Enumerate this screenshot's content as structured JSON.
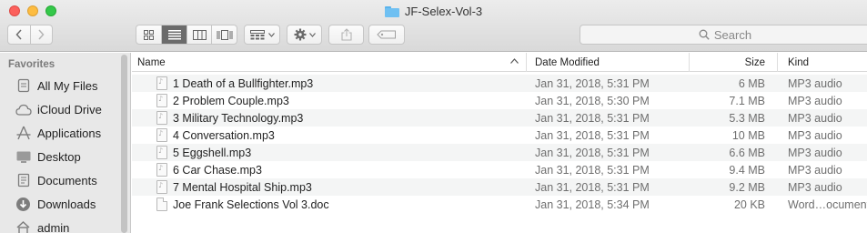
{
  "window": {
    "title": "JF-Selex-Vol-3"
  },
  "toolbar": {
    "back_icon": "chevron-left-icon",
    "forward_icon": "chevron-right-icon",
    "view_modes": [
      "icon",
      "list",
      "column",
      "cover-flow"
    ],
    "active_view": "list",
    "search_placeholder": "Search"
  },
  "sidebar": {
    "heading": "Favorites",
    "items": [
      {
        "label": "All My Files",
        "icon": "all-files-icon"
      },
      {
        "label": "iCloud Drive",
        "icon": "cloud-icon"
      },
      {
        "label": "Applications",
        "icon": "applications-icon"
      },
      {
        "label": "Desktop",
        "icon": "desktop-icon"
      },
      {
        "label": "Documents",
        "icon": "documents-icon"
      },
      {
        "label": "Downloads",
        "icon": "downloads-icon"
      },
      {
        "label": "admin",
        "icon": "home-icon"
      }
    ]
  },
  "columns": {
    "name": "Name",
    "date": "Date Modified",
    "size": "Size",
    "kind": "Kind"
  },
  "files": [
    {
      "name": "1 Death of a Bullfighter.mp3",
      "date": "Jan 31, 2018, 5:31 PM",
      "size": "6 MB",
      "kind": "MP3 audio",
      "type": "audio"
    },
    {
      "name": "2 Problem Couple.mp3",
      "date": "Jan 31, 2018, 5:30 PM",
      "size": "7.1 MB",
      "kind": "MP3 audio",
      "type": "audio"
    },
    {
      "name": "3 Military Technology.mp3",
      "date": "Jan 31, 2018, 5:31 PM",
      "size": "5.3 MB",
      "kind": "MP3 audio",
      "type": "audio"
    },
    {
      "name": "4 Conversation.mp3",
      "date": "Jan 31, 2018, 5:31 PM",
      "size": "10 MB",
      "kind": "MP3 audio",
      "type": "audio"
    },
    {
      "name": "5 Eggshell.mp3",
      "date": "Jan 31, 2018, 5:31 PM",
      "size": "6.6 MB",
      "kind": "MP3 audio",
      "type": "audio"
    },
    {
      "name": "6 Car Chase.mp3",
      "date": "Jan 31, 2018, 5:31 PM",
      "size": "9.4 MB",
      "kind": "MP3 audio",
      "type": "audio"
    },
    {
      "name": "7 Mental Hospital Ship.mp3",
      "date": "Jan 31, 2018, 5:31 PM",
      "size": "9.2 MB",
      "kind": "MP3 audio",
      "type": "audio"
    },
    {
      "name": "Joe Frank Selections Vol 3.doc",
      "date": "Jan 31, 2018, 5:34 PM",
      "size": "20 KB",
      "kind": "Word…ocument",
      "type": "doc"
    }
  ]
}
